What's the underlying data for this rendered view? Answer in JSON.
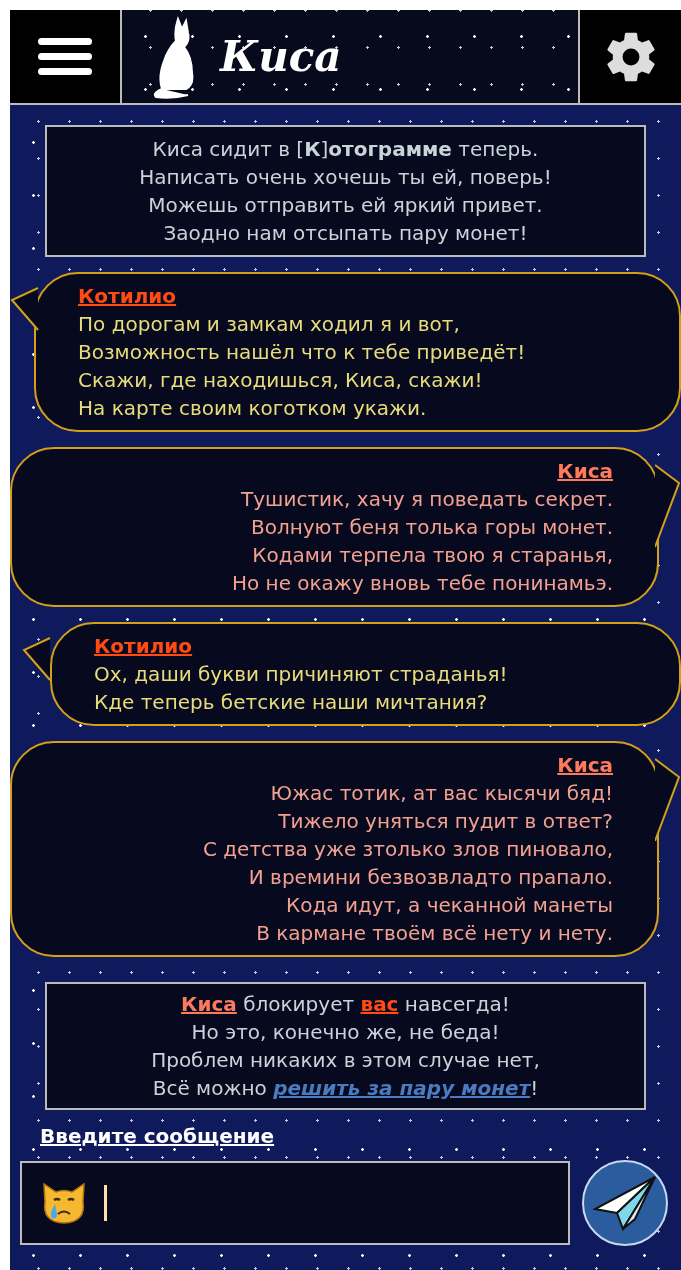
{
  "header": {
    "title": "Киса"
  },
  "notice": {
    "lines": [
      "Киса сидит в [**К**]**отограмме** теперь.",
      "Написать очень хочешь ты ей, поверь!",
      "Можешь отправить ей яркий привет.",
      "Заодно нам отсыпать пару монет!"
    ]
  },
  "messages": [
    {
      "kind": "incoming",
      "author": "Котилио",
      "lines": [
        "По дорогам и замкам ходил я и вот,",
        "Возможность нашёл что к тебе приведёт!",
        "Скажи, где находишься, Киса, скажи!",
        "На карте своим коготком укажи."
      ]
    },
    {
      "kind": "outgoing",
      "author": "Киса",
      "lines": [
        "Тушистик, хачу я поведать секрет.",
        "Волнуют беня толька горы монет.",
        "Кодами терпела твою я старанья,",
        "Но не окажу вновь тебе понинамьэ."
      ]
    },
    {
      "kind": "incoming",
      "author": "Котилио",
      "lines": [
        "Ох, даши букви причиняют страданья!",
        "Кде теперь бетские наши мичтания?"
      ]
    },
    {
      "kind": "outgoing",
      "author": "Киса",
      "lines": [
        "Южас тотик, ат вас кысячи бяд!",
        "Тижело уняться пудит в ответ?",
        "С детства уже зтолько злов пиновало,",
        "И времини безвозвладто прапало.",
        "Кода идут, а чеканной манеты",
        "В кармане твоём всё нету и нету."
      ]
    }
  ],
  "block_notice": {
    "lines": [
      [
        {
          "kind": "author",
          "text": "Киса"
        },
        {
          "kind": "plain",
          "text": " блокирует "
        },
        {
          "kind": "you",
          "text": "вас"
        },
        {
          "kind": "plain",
          "text": " навсегда!"
        }
      ],
      [
        {
          "kind": "plain",
          "text": "Но это, конечно же, не беда!"
        }
      ],
      [
        {
          "kind": "plain",
          "text": "Проблем никаких в этом случае нет,"
        }
      ],
      [
        {
          "kind": "plain",
          "text": "Всё можно "
        },
        {
          "kind": "pay",
          "text": "решить за пару монет"
        },
        {
          "kind": "plain",
          "text": "!"
        }
      ]
    ]
  },
  "composer": {
    "label": "Введите сообщение"
  }
}
